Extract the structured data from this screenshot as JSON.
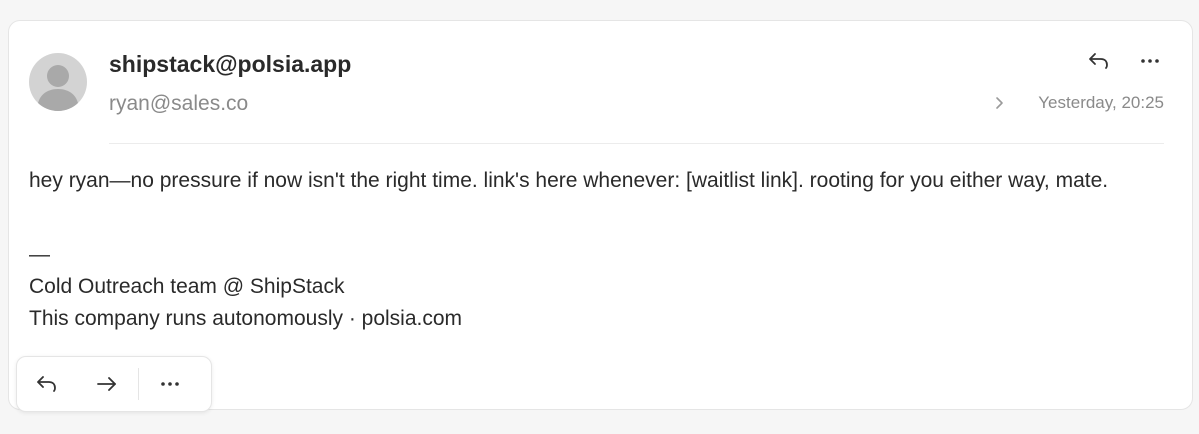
{
  "message": {
    "from": "shipstack@polsia.app",
    "to": "ryan@sales.co",
    "timestamp": "Yesterday, 20:25",
    "body": "hey ryan—no pressure if now isn't the right time. link's here whenever: [waitlist link]. rooting for you either way, mate.",
    "signature_dash": "—",
    "signature_line1": "Cold Outreach team @ ShipStack",
    "signature_line2": "This company runs autonomously · polsia.com"
  },
  "icons": {
    "header_reply": "reply-icon",
    "header_more": "more-icon",
    "expand": "chevron-right-icon",
    "toolbar_reply": "reply-icon",
    "toolbar_forward": "forward-icon",
    "toolbar_more": "more-icon"
  },
  "colors": {
    "card_bg": "#ffffff",
    "page_bg": "#f6f6f6",
    "text": "#2a2a2a",
    "muted": "#8a8a8a",
    "avatar": "#d3d3d3"
  }
}
